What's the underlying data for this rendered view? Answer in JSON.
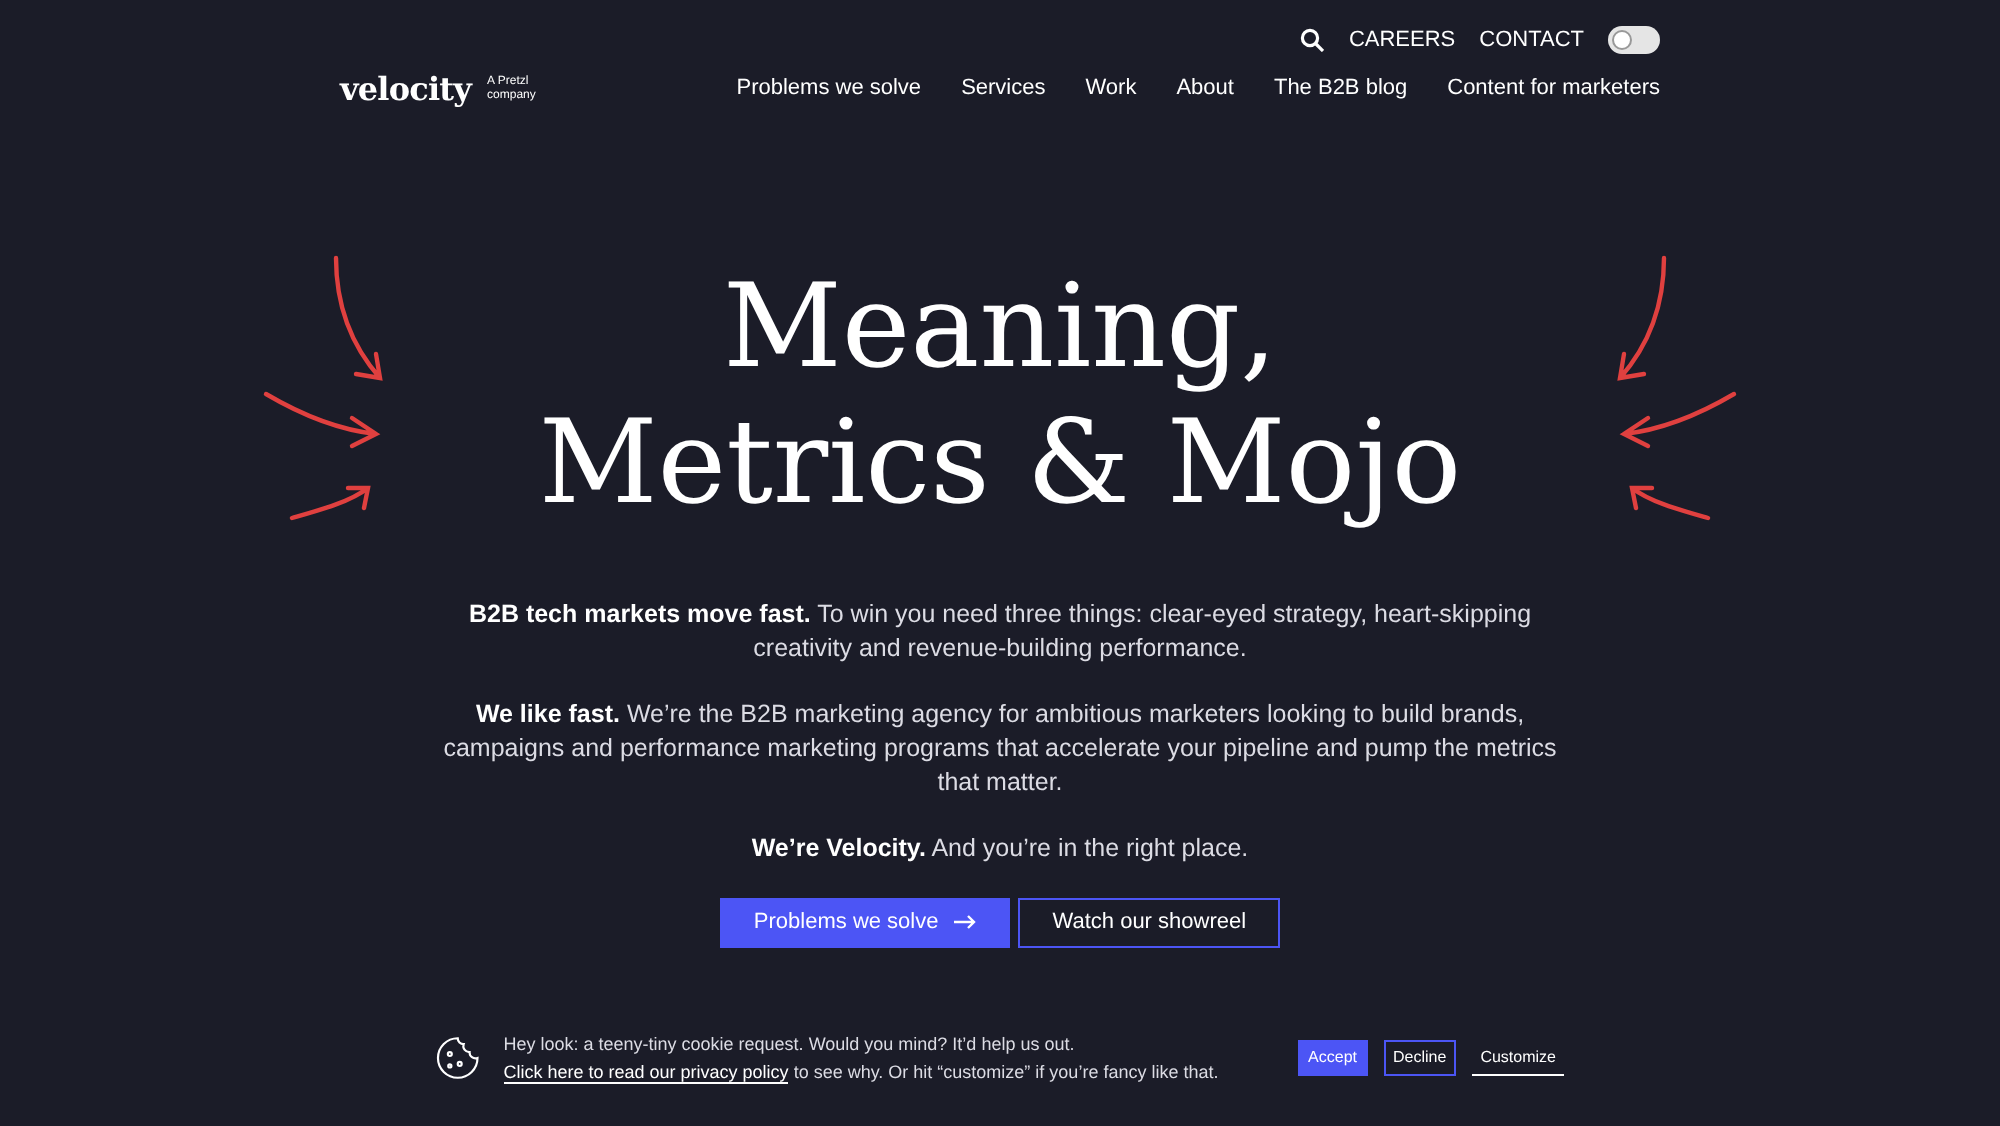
{
  "header": {
    "logo": "velocity",
    "logo_tagline_lines": [
      "A Pretzl",
      "company"
    ],
    "utility_links": [
      "CAREERS",
      "CONTACT"
    ],
    "light_mode": {
      "on": false
    },
    "nav": [
      "Problems we solve",
      "Services",
      "Work",
      "About",
      "The B2B blog",
      "Content for marketers"
    ]
  },
  "hero": {
    "title_lines": [
      "Meaning,",
      "Metrics & Mojo"
    ],
    "paragraphs": [
      "**B2B tech markets move fast.** To win you need three things: clear-eyed strategy, heart-skipping creativity and revenue-building performance.",
      "**We like fast.** We’re the B2B marketing agency for ambitious marketers looking to build brands, campaigns and performance marketing programs that accelerate your pipeline and pump the metrics that matter.",
      "**We’re Velocity.** And you’re in the right place."
    ],
    "buttons": [
      {
        "label": "Problems we solve",
        "kind": "primary"
      },
      {
        "label": "Watch our showreel",
        "kind": "outline"
      }
    ]
  },
  "cookie_banner": {
    "text_before": "Hey look: a teeny-tiny cookie request. Would you mind? It’d help us out.",
    "link": "Click here to read our privacy policy",
    "text_after": "to see why. Or hit “customize” if you’re fancy like that.",
    "buttons": [
      {
        "label": "Accept",
        "kind": "primary"
      },
      {
        "label": "Decline",
        "kind": "outline"
      },
      {
        "label": "Customize",
        "kind": "link"
      }
    ]
  }
}
